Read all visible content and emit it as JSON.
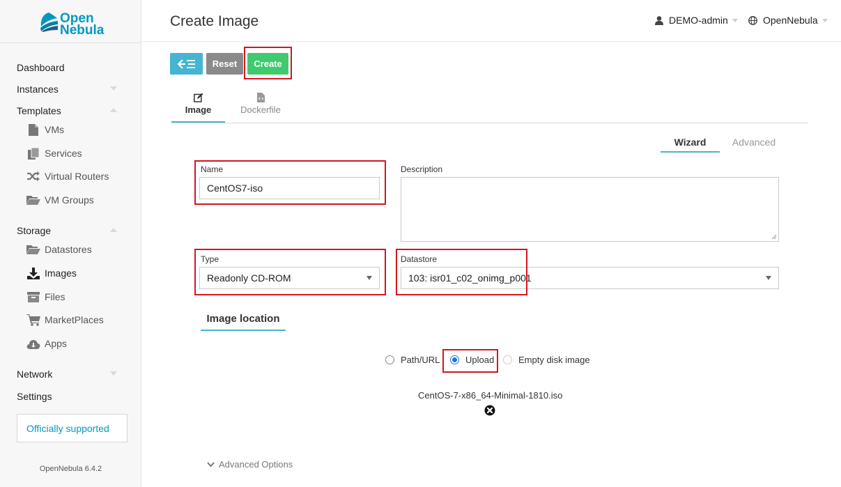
{
  "brand": {
    "line1": "Open",
    "line2": "Nebula",
    "color": "#0098c3"
  },
  "sidebar": {
    "dashboard": "Dashboard",
    "instances": "Instances",
    "templates": "Templates",
    "templates_items": [
      "VMs",
      "Services",
      "Virtual Routers",
      "VM Groups"
    ],
    "storage": "Storage",
    "storage_items": [
      "Datastores",
      "Images",
      "Files",
      "MarketPlaces",
      "Apps"
    ],
    "network": "Network",
    "settings": "Settings",
    "support": "Officially supported",
    "version": "OpenNebula 6.4.2"
  },
  "header": {
    "title": "Create Image",
    "user": "DEMO-admin",
    "zone": "OpenNebula"
  },
  "toolbar": {
    "reset_label": "Reset",
    "create_label": "Create"
  },
  "tabs": {
    "image": "Image",
    "dockerfile": "Dockerfile"
  },
  "wizard_tabs": {
    "wizard": "Wizard",
    "advanced": "Advanced"
  },
  "form": {
    "name_label": "Name",
    "name_value": "CentOS7-iso",
    "description_label": "Description",
    "type_label": "Type",
    "type_value": "Readonly CD-ROM",
    "datastore_label": "Datastore",
    "datastore_value": "103: isr01_c02_onimg_p001"
  },
  "image_location": {
    "title": "Image location",
    "options": [
      "Path/URL",
      "Upload",
      "Empty disk image"
    ],
    "selected": "Upload",
    "filename": "CentOS-7-x86_64-Minimal-1810.iso"
  },
  "advanced_options": "Advanced Options",
  "colors": {
    "accent": "#45b5d1",
    "create": "#3fca6e",
    "reset": "#8a8a8a",
    "highlight": "#d0161f"
  }
}
